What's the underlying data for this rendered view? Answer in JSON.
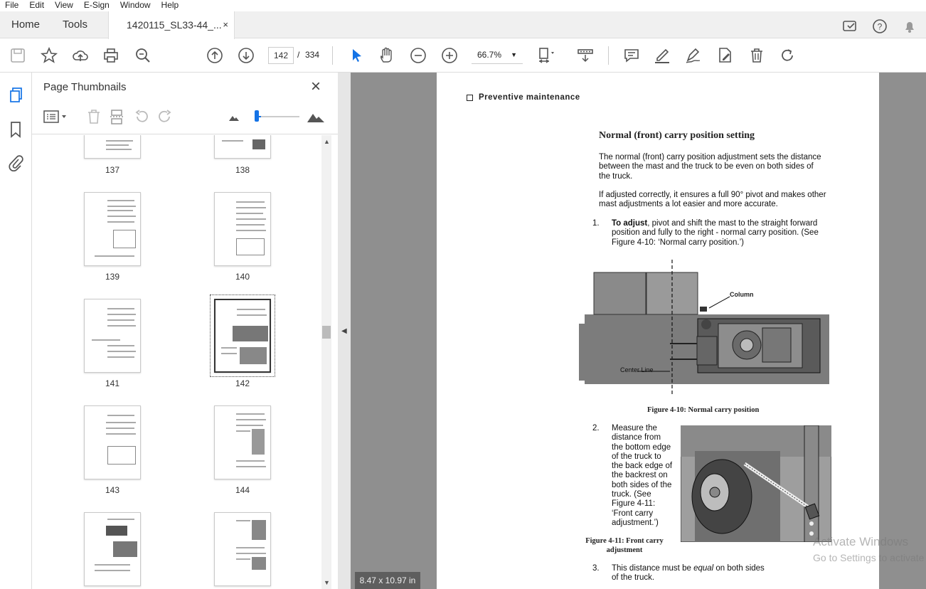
{
  "menu": [
    "File",
    "Edit",
    "View",
    "E-Sign",
    "Window",
    "Help"
  ],
  "tabs": {
    "home": "Home",
    "tools": "Tools",
    "doc": "1420115_SL33-44_...",
    "close": "×"
  },
  "toolbar": {
    "page_current": "142",
    "page_sep": "/",
    "page_total": "334",
    "zoom": "66.7%"
  },
  "panel": {
    "title": "Page Thumbnails",
    "close": "×"
  },
  "thumbnails": [
    "137",
    "138",
    "139",
    "140",
    "141",
    "142",
    "143",
    "144",
    "",
    ""
  ],
  "doc": {
    "section": "Preventive maintenance",
    "heading": "Normal (front) carry position setting",
    "p1": "The normal (front) carry position adjustment sets the distance between the mast and the truck to be even on both sides of the truck.",
    "p2": "If  adjusted correctly, it ensures a full 90° pivot and makes other mast adjustments a lot easier and more accurate.",
    "step1_num": "1.",
    "step1_bold": "To adjust",
    "step1_text": ", pivot and shift the mast to the straight forward position and fully to the right - normal carry position.  (See Figure 4-10: ‘Normal carry position.’)",
    "label_column": "Column",
    "label_centerline": "Center Line",
    "fig1_caption": "Figure 4-10: Normal carry position",
    "step2_num": "2.",
    "step2_text": "Measure the distance from the bottom edge of the truck to the back edge of the backrest on both sides of the truck.  (See Figure 4-11: ‘Front carry adjustment.’)",
    "fig2_caption": "Figure 4-11: Front carry adjustment",
    "step3_num": "3.",
    "step3_text": "This distance must be equal on both sides of the truck.",
    "step3_em": "equal"
  },
  "size_badge": "8.47 x 10.97 in",
  "watermark": {
    "line1": "Activate Windows",
    "line2": "Go to Settings to activate"
  }
}
